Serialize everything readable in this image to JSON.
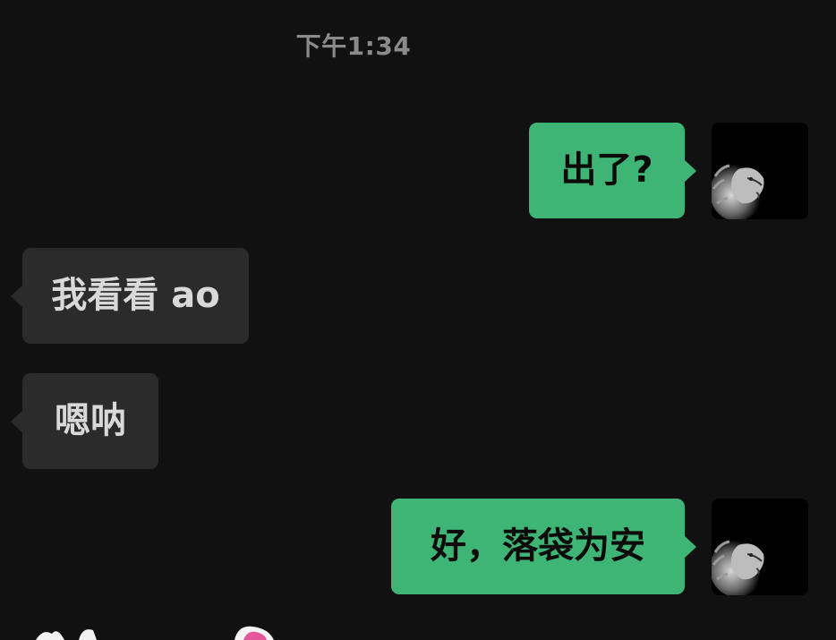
{
  "chat": {
    "timestamp": "下午1:34",
    "messages": [
      {
        "direction": "outgoing",
        "text": "出了?"
      },
      {
        "direction": "incoming",
        "text": "我看看 ao"
      },
      {
        "direction": "incoming",
        "text": "嗯呐"
      },
      {
        "direction": "outgoing",
        "text": "好，落袋为安"
      }
    ],
    "self_avatar": {
      "icon": "lion-avatar-icon"
    }
  },
  "colors": {
    "background": "#111111",
    "outgoing_bubble": "#3eb575",
    "incoming_bubble": "#2b2b2b",
    "timestamp_text": "#8a8a8a"
  }
}
